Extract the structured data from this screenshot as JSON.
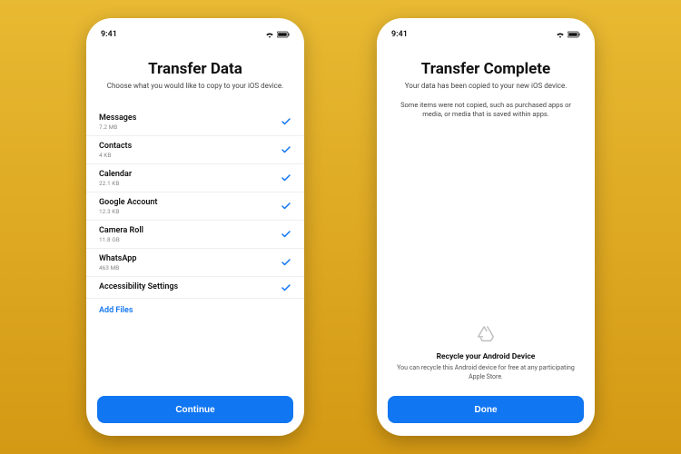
{
  "status": {
    "time": "9:41"
  },
  "screen1": {
    "title": "Transfer Data",
    "subtitle": "Choose what you would like to copy to your iOS device.",
    "items": [
      {
        "label": "Messages",
        "size": "7.2 MB"
      },
      {
        "label": "Contacts",
        "size": "4 KB"
      },
      {
        "label": "Calendar",
        "size": "22.1 KB"
      },
      {
        "label": "Google Account",
        "size": "12.3 KB"
      },
      {
        "label": "Camera Roll",
        "size": "11.8 GB"
      },
      {
        "label": "WhatsApp",
        "size": "463 MB"
      },
      {
        "label": "Accessibility Settings",
        "size": ""
      }
    ],
    "add_files": "Add Files",
    "continue": "Continue"
  },
  "screen2": {
    "title": "Transfer Complete",
    "subtitle": "Your data has been copied to your new iOS device.",
    "note": "Some items were not copied, such as purchased apps or media, or media that is saved within apps.",
    "recycle_title": "Recycle your Android Device",
    "recycle_text": "You can recycle this Android device for free at any participating Apple Store.",
    "done": "Done"
  }
}
